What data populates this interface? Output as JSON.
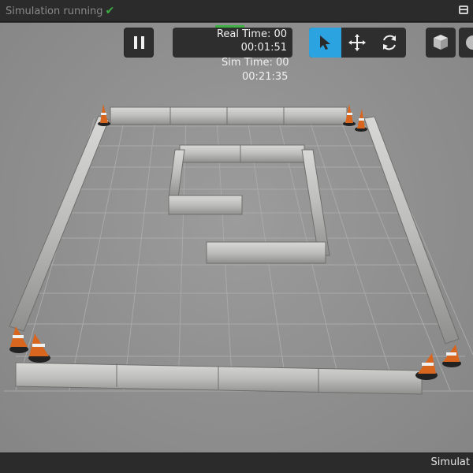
{
  "titlebar": {
    "status_text": "Simulation running",
    "status_icon": "check-icon",
    "status_color": "#3cb043"
  },
  "toolbar": {
    "pause_icon": "pause-icon",
    "real_time_label": "Real Time: 00",
    "real_time_value": "00:01:51",
    "sim_time_label": "Sim Time: 00",
    "sim_time_value": "00:21:35",
    "tools": [
      {
        "name": "select",
        "icon": "arrow-cursor-icon",
        "active": true
      },
      {
        "name": "translate",
        "icon": "move-arrows-icon",
        "active": false
      },
      {
        "name": "rotate",
        "icon": "rotate-icon",
        "active": false
      }
    ],
    "shapes": [
      "box-icon",
      "sphere-icon"
    ],
    "accent_color": "#2aa3e0"
  },
  "scene": {
    "ground": "grid-plane",
    "objects": [
      "concrete-barrier-walls",
      "traffic-cones"
    ]
  },
  "bottombar": {
    "text": "Simulat"
  }
}
